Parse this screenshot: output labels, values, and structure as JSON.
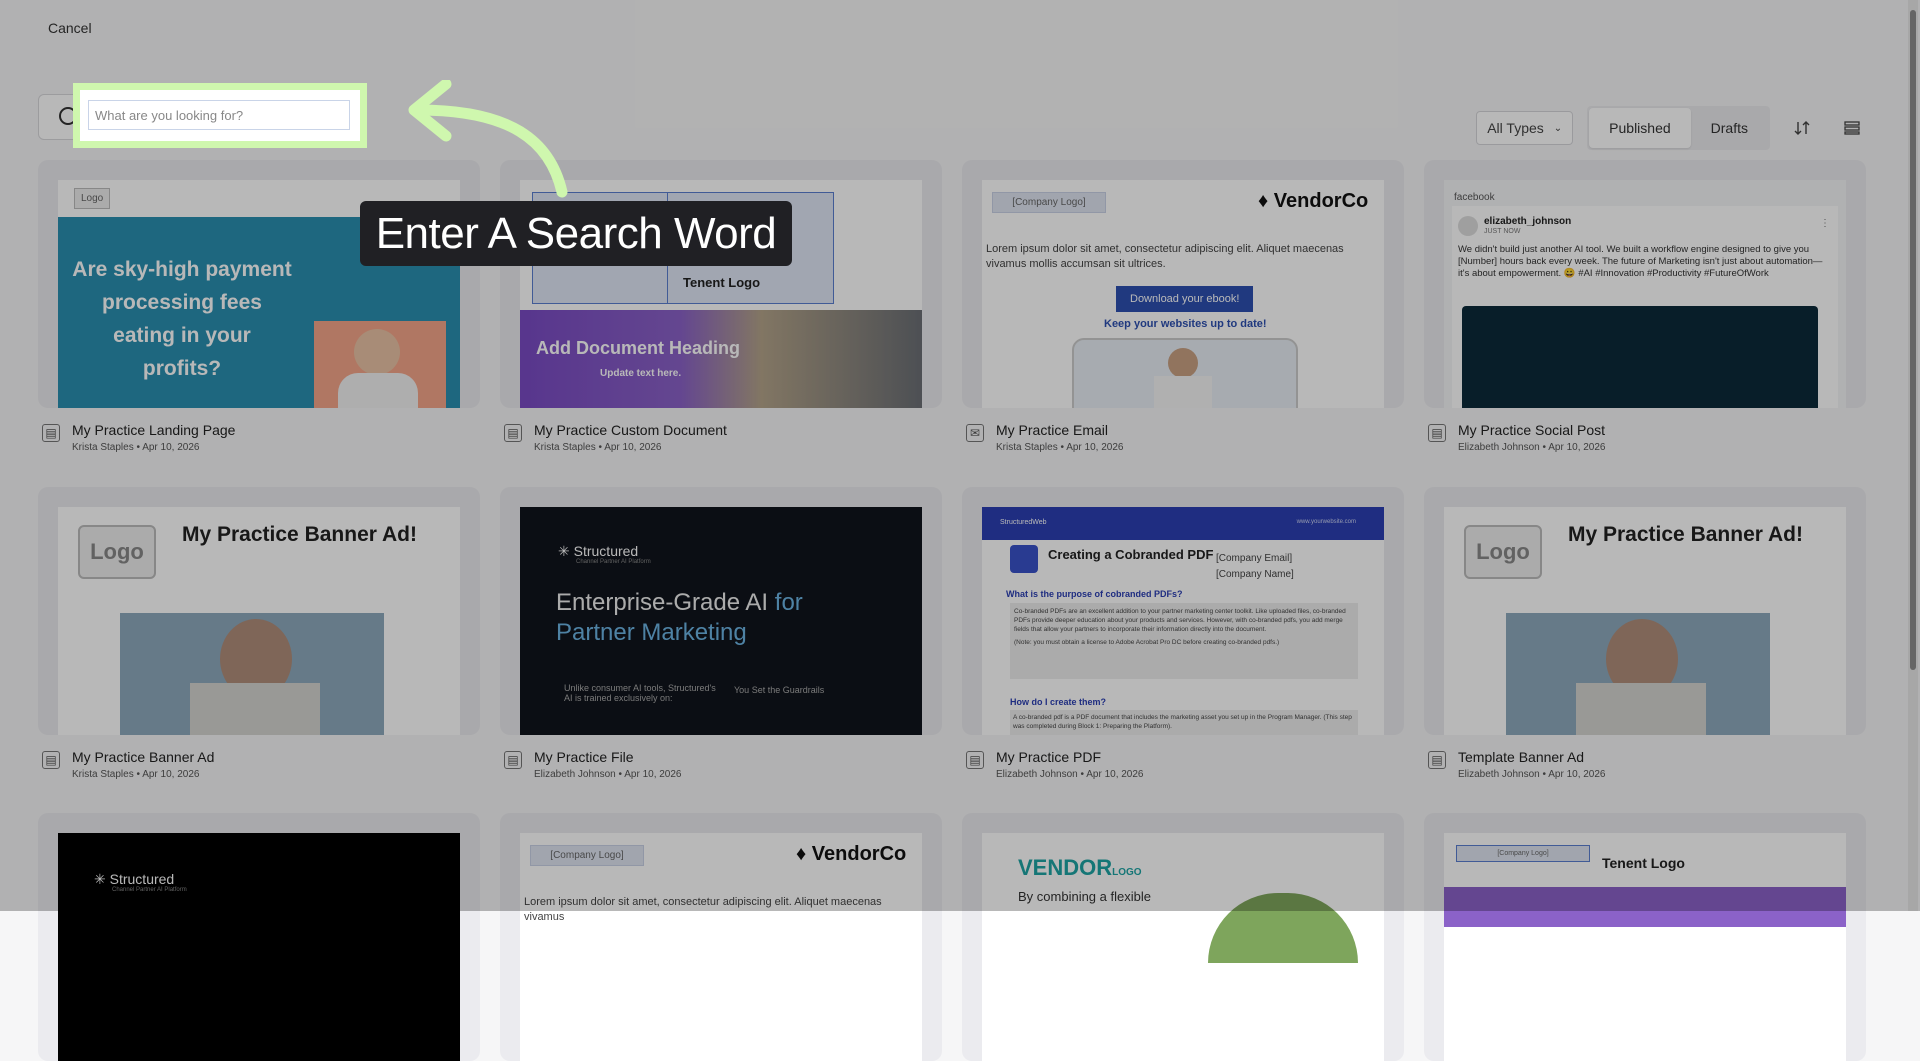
{
  "cancel_label": "Cancel",
  "search": {
    "placeholder": "What are you looking for?"
  },
  "toolbar": {
    "type_select": "All Types",
    "tabs": [
      "Published",
      "Drafts"
    ],
    "active_tab": "Published"
  },
  "tooltip": "Enter A Search Word",
  "cards": [
    {
      "title": "My Practice Landing Page",
      "sub": "Krista Staples • Apr 10, 2026",
      "icon": "landing-page-icon",
      "thumb": {
        "logo": "Logo",
        "headline": "Are sky-high payment processing fees eating in your profits?"
      }
    },
    {
      "title": "My Practice Custom Document",
      "sub": "Krista Staples • Apr 10, 2026",
      "icon": "document-icon",
      "thumb": {
        "logo": "Tenent Logo",
        "heading": "Add Document Heading",
        "sub": "Update text here."
      }
    },
    {
      "title": "My Practice Email",
      "sub": "Krista Staples • Apr 10, 2026",
      "icon": "email-icon",
      "thumb": {
        "logo": "[Company Logo]",
        "brand": "VendorCo",
        "body": "Lorem ipsum dolor sit amet, consectetur adipiscing elit. Aliquet maecenas vivamus mollis accumsan sit ultrices.",
        "button": "Download your ebook!",
        "link": "Keep your websites up to date!"
      }
    },
    {
      "title": "My Practice Social Post",
      "sub": "Elizabeth Johnson • Apr 10, 2026",
      "icon": "social-post-icon",
      "thumb": {
        "network": "facebook",
        "user": "elizabeth_johnson",
        "time": "JUST NOW",
        "text": "We didn't build just another AI tool. We built a workflow engine designed to give you [Number] hours back every week. The future of Marketing isn't just about automation—it's about empowerment. 😀 #AI #Innovation #Productivity #FutureOfWork"
      }
    },
    {
      "title": "My Practice Banner Ad",
      "sub": "Krista Staples • Apr 10, 2026",
      "icon": "banner-ad-icon",
      "thumb": {
        "logo": "Logo",
        "heading": "My Practice Banner Ad!"
      }
    },
    {
      "title": "My Practice File",
      "sub": "Elizabeth Johnson • Apr 10, 2026",
      "icon": "file-icon",
      "thumb": {
        "brand": "Structured",
        "tagline": "Channel Partner AI Platform",
        "h1": "Enterprise-Grade AI",
        "h1b": "for",
        "h2": "Partner Marketing",
        "col1": "Unlike consumer AI tools, Structured's AI is trained exclusively on:",
        "col2": "You Set the Guardrails"
      }
    },
    {
      "title": "My Practice PDF",
      "sub": "Elizabeth Johnson • Apr 10, 2026",
      "icon": "pdf-icon",
      "thumb": {
        "brand": "StructuredWeb",
        "url": "www.yourwebsite.com",
        "heading": "Creating a Cobranded PDF",
        "email": "[Company Email]",
        "name": "[Company Name]",
        "q1": "What is the purpose of cobranded PDFs?",
        "p1": "Co-branded PDFs are an excellent addition to your partner marketing center toolkit. Like uploaded files, co-branded PDFs provide deeper education about your products and services. However, with co-branded pdfs, you add merge fields that allow your partners to incorporate their information directly into the document.",
        "note": "(Note: you must obtain a license to Adobe Acrobat Pro DC before creating co-branded pdfs.)",
        "q2": "How do I create them?",
        "p2": "A co-branded pdf is a PDF document that includes the marketing asset you set up in the Program Manager. (This step was completed during Block 1: Preparing the Platform)."
      }
    },
    {
      "title": "Template Banner Ad",
      "sub": "Elizabeth Johnson • Apr 10, 2026",
      "icon": "banner-ad-icon",
      "thumb": {
        "logo": "Logo",
        "heading": "My Practice Banner Ad!"
      }
    },
    {
      "thumb": {
        "brand": "Structured",
        "tagline": "Channel Partner AI Platform"
      }
    },
    {
      "thumb": {
        "logo": "[Company Logo]",
        "brand": "VendorCo",
        "body": "Lorem ipsum dolor sit amet, consectetur adipiscing elit. Aliquet maecenas vivamus"
      }
    },
    {
      "thumb": {
        "brand": "VENDOR",
        "brand_small": "LOGO",
        "body": "By combining a flexible"
      }
    },
    {
      "thumb": {
        "logo": "[Company Logo]",
        "brand": "Tenent Logo"
      }
    }
  ]
}
